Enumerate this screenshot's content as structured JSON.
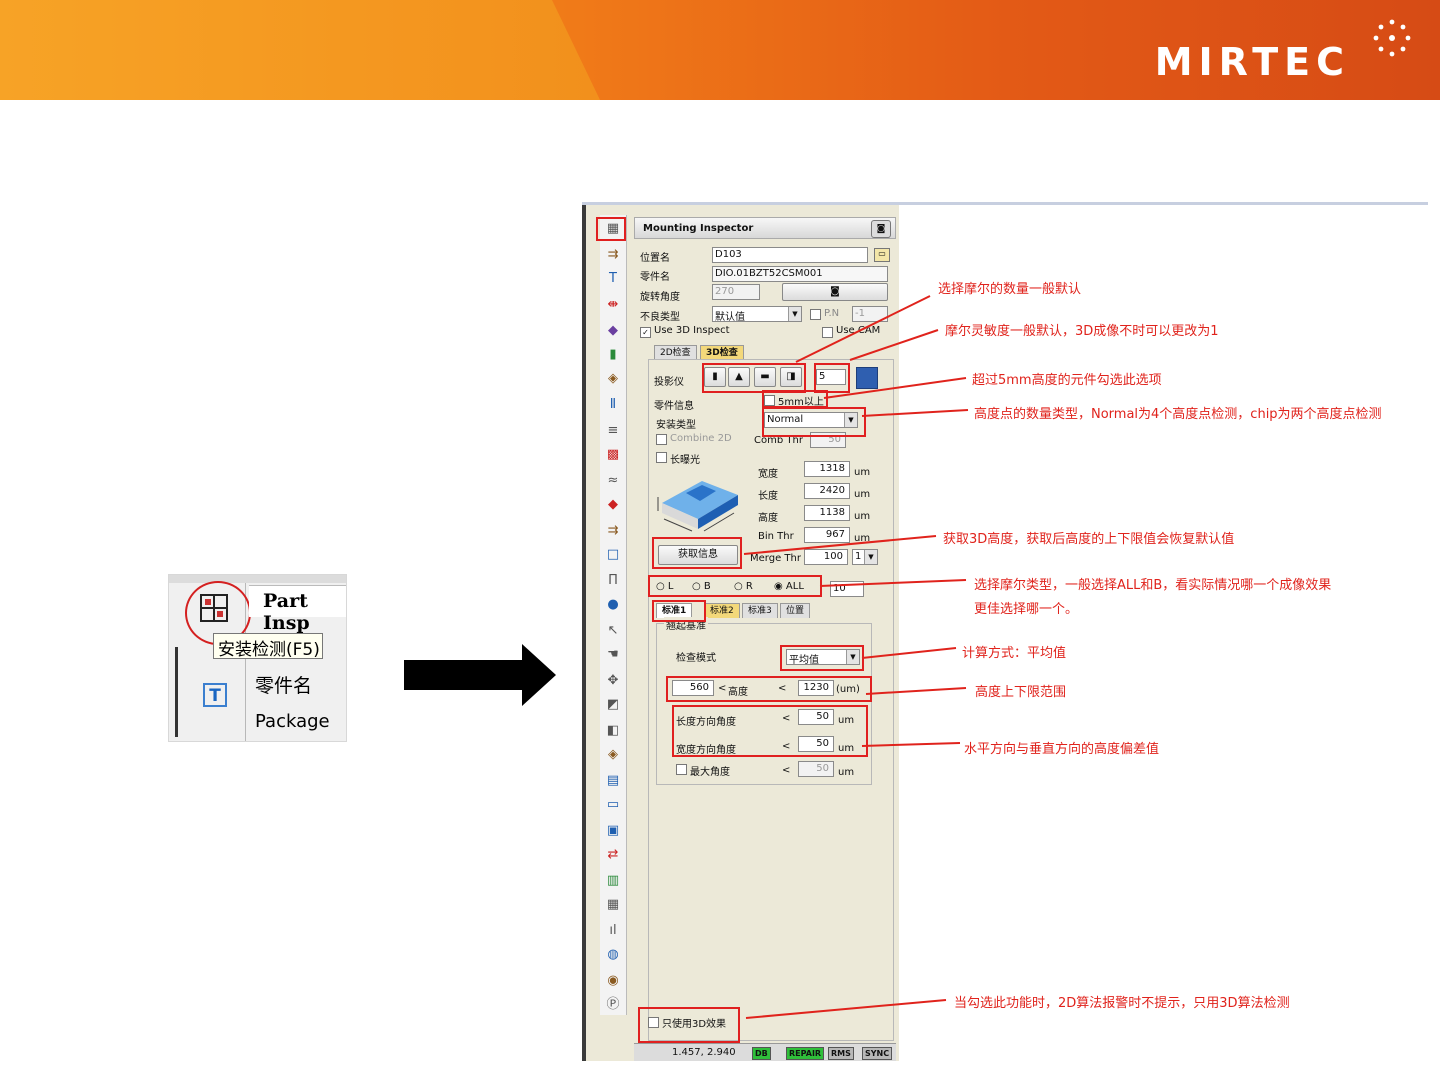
{
  "banner": {
    "logo_text": "MIRTEC",
    "gradient_start": "#f39a1a",
    "gradient_end": "#d64b15"
  },
  "inset": {
    "part_label": "Part Insp",
    "tooltip": "安装检测(F5)",
    "t_icon": "T",
    "field1": "零件名",
    "field2": "Package"
  },
  "window": {
    "title": "Mounting Inspector",
    "location_label": "位置名",
    "location_value": "D103",
    "part_label": "零件名",
    "part_value": "DIO.01BZT52CSM001",
    "rotation_label": "旋转角度",
    "rotation_value": "270",
    "defect_label": "不良类型",
    "defect_value": "默认值",
    "pn_label": "P.N",
    "pn_value": "-1",
    "use3d_label": "Use 3D Inspect",
    "usecam_label": "Use CAM",
    "tab_2d": "2D检查",
    "tab_3d": "3D检查",
    "projector_label": "投影仪",
    "moire_count": "5",
    "part_info_label": "零件信息",
    "over5mm_label": "5mm以上",
    "mount_type_label": "安装类型",
    "mount_type_value": "Normal",
    "combine2d_label": "Combine 2D",
    "combthr_label": "Comb Thr",
    "combthr_value": "50",
    "long_exposure_label": "长曝光",
    "width_label": "宽度",
    "width_value": "1318",
    "length_label": "长度",
    "length_value": "2420",
    "height_label": "高度",
    "height_value": "1138",
    "binthr_label": "Bin Thr",
    "binthr_value": "967",
    "unit_um": "um",
    "get_info_button": "获取信息",
    "mergethr_label": "Merge Thr",
    "mergethr_value": "100",
    "merge_combo": "1",
    "radio_l": "L",
    "radio_b": "B",
    "radio_r": "R",
    "radio_all": "ALL",
    "radio_value": "10",
    "std_tab1": "标准1",
    "std_tab2": "标准2",
    "std_tab3": "标准3",
    "std_tab4": "位置",
    "group_title": "翘起基准",
    "mode_label": "检查模式",
    "mode_value": "平均值",
    "height_min": "560",
    "height_lt": "<",
    "height_mid_label": "高度",
    "height_max": "1230",
    "height_unit": "(um)",
    "len_angle_label": "长度方向角度",
    "len_angle_value": "50",
    "wid_angle_label": "宽度方向角度",
    "wid_angle_value": "50",
    "max_angle_label": "最大角度",
    "max_angle_value": "50",
    "only3d_label": "只使用3D效果",
    "status_coords": "1.457, 2.940",
    "status_db": "DB",
    "status_repair": "REPAIR",
    "status_rms": "RMS",
    "status_sync": "SYNC"
  },
  "notes": {
    "n1": "选择摩尔的数量一般默认",
    "n2": "摩尔灵敏度一般默认，3D成像不时可以更改为1",
    "n3": "超过5mm高度的元件勾选此选项",
    "n4": "高度点的数量类型，Normal为4个高度点检测，chip为两个高度点检测",
    "n5": "获取3D高度，获取后高度的上下限值会恢复默认值",
    "n6a": "选择摩尔类型，一般选择ALL和B，看实际情况哪一个成像效果",
    "n6b": "更佳选择哪一个。",
    "n7": "计算方式：平均值",
    "n8": "高度上下限范围",
    "n9": "水平方向与垂直方向的高度偏差值",
    "n10": "当勾选此功能时，2D算法报警时不提示，只用3D算法检测"
  }
}
